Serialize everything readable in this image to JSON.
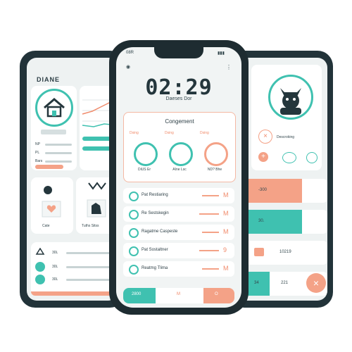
{
  "left_app": {
    "title": "DIANE",
    "labels": [
      "NP",
      "PL",
      "Bars"
    ],
    "pet_caption": "Cate",
    "dog_caption": "Tuths Sitss",
    "slider_values": [
      "30L",
      "30L",
      "30L"
    ]
  },
  "center_app": {
    "status_left": "08R",
    "time": "02:29",
    "subtitle": "Daeses Dor",
    "card_title": "Congement",
    "pets": [
      {
        "tag": "Dsing",
        "name": "DiUS Er"
      },
      {
        "tag": "Dsing",
        "name": "AIne Lsc"
      },
      {
        "tag": "Dsing",
        "name": "ND? Bhe"
      }
    ],
    "list": [
      {
        "label": "Pat Restiaring",
        "end": "M"
      },
      {
        "label": "Re Sestskegin",
        "end": "M"
      },
      {
        "label": "Ragatme Caspeste",
        "end": "M"
      },
      {
        "label": "Pat Sostaltner",
        "end": "9"
      },
      {
        "label": "Reatmg Tlima",
        "end": "M"
      }
    ],
    "bottom": {
      "left": "2800",
      "center": "M",
      "right": "O"
    }
  },
  "right_app": {
    "action_label": "Descroking",
    "rows": [
      {
        "value": "-300",
        "color": "#f4a287"
      },
      {
        "value": "30.",
        "color": "#3fc1b0"
      },
      {
        "value": "10219",
        "color": "#ffffff"
      },
      {
        "value": "221",
        "color": "#3fc1b0"
      }
    ],
    "row_left_values": [
      "30",
      "34"
    ]
  },
  "colors": {
    "teal": "#3fc1b0",
    "orange": "#f4a287",
    "dark": "#223339"
  }
}
